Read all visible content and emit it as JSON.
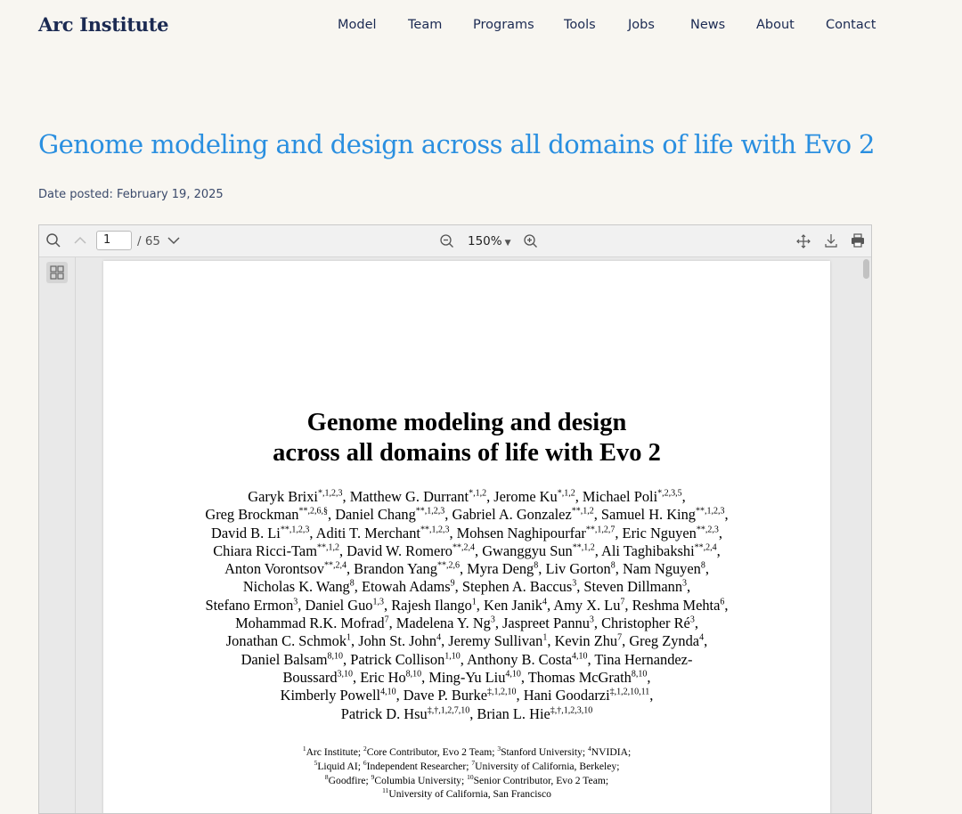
{
  "site": {
    "logo": "Arc Institute",
    "nav": [
      "Model",
      "Team",
      "Programs",
      "Tools",
      "Jobs",
      "News",
      "About",
      "Contact"
    ]
  },
  "article": {
    "title": "Genome modeling and design across all domains of life with Evo 2",
    "date_posted": "Date posted: February 19, 2025"
  },
  "viewer": {
    "current_page": "1",
    "total_pages": "/ 65",
    "zoom": "150%",
    "icons": [
      "search-icon",
      "chevron-up-icon",
      "chevron-down-icon",
      "zoom-out-icon",
      "zoom-in-icon",
      "move-icon",
      "download-icon",
      "print-icon",
      "thumbnails-icon"
    ]
  },
  "pdf": {
    "title_line1": "Genome modeling and design",
    "title_line2": "across all domains of life with Evo 2",
    "authors": [
      "Garyk Brixi<sup>*,1,2,3</sup>, Matthew G. Durrant<sup>*,1,2</sup>, Jerome Ku<sup>*,1,2</sup>, Michael Poli<sup>*,2,3,5</sup>,",
      "Greg Brockman<sup>**,2,6,§</sup>, Daniel Chang<sup>**,1,2,3</sup>, Gabriel A. Gonzalez<sup>**,1,2</sup>, Samuel H. King<sup>**,1,2,3</sup>,",
      "David B. Li<sup>**,1,2,3</sup>, Aditi T. Merchant<sup>**,1,2,3</sup>, Mohsen Naghipourfar<sup>**,1,2,7</sup>, Eric Nguyen<sup>**,2,3</sup>,",
      "Chiara Ricci-Tam<sup>**,1,2</sup>, David W. Romero<sup>**,2,4</sup>, Gwanggyu Sun<sup>**,1,2</sup>, Ali Taghibakshi<sup>**,2,4</sup>,",
      "Anton Vorontsov<sup>**,2,4</sup>, Brandon Yang<sup>**,2,6</sup>, Myra Deng<sup>8</sup>, Liv Gorton<sup>8</sup>, Nam Nguyen<sup>8</sup>,",
      "Nicholas K. Wang<sup>8</sup>, Etowah Adams<sup>9</sup>, Stephen A. Baccus<sup>3</sup>, Steven Dillmann<sup>3</sup>,",
      "Stefano Ermon<sup>3</sup>, Daniel Guo<sup>1,3</sup>, Rajesh Ilango<sup>1</sup>, Ken Janik<sup>4</sup>, Amy X. Lu<sup>7</sup>, Reshma Mehta<sup>6</sup>,",
      "Mohammad R.K. Mofrad<sup>7</sup>, Madelena Y. Ng<sup>3</sup>, Jaspreet Pannu<sup>3</sup>, Christopher Ré<sup>3</sup>,",
      "Jonathan C. Schmok<sup>1</sup>, John St. John<sup>4</sup>, Jeremy Sullivan<sup>1</sup>, Kevin Zhu<sup>7</sup>, Greg Zynda<sup>4</sup>,",
      "Daniel Balsam<sup>8,10</sup>, Patrick Collison<sup>1,10</sup>, Anthony B. Costa<sup>4,10</sup>, Tina Hernandez-",
      "Boussard<sup>3,10</sup>, Eric Ho<sup>8,10</sup>, Ming-Yu Liu<sup>4,10</sup>, Thomas McGrath<sup>8,10</sup>,",
      "Kimberly Powell<sup>4,10</sup>, Dave P. Burke<sup>‡,1,2,10</sup>, Hani Goodarzi<sup>‡,1,2,10,11</sup>,",
      "Patrick D. Hsu<sup>‡,†,1,2,7,10</sup>, Brian L. Hie<sup>‡,†,1,2,3,10</sup>"
    ],
    "affiliations": [
      "<sup>1</sup>Arc Institute; <sup>2</sup>Core Contributor, Evo 2 Team; <sup>3</sup>Stanford University; <sup>4</sup>NVIDIA;",
      "<sup>5</sup>Liquid AI; <sup>6</sup>Independent Researcher; <sup>7</sup>University of California, Berkeley;",
      "<sup>8</sup>Goodfire; <sup>9</sup>Columbia University; <sup>10</sup>Senior Contributor, Evo 2 Team;",
      "<sup>11</sup>University of California, San Francisco"
    ]
  }
}
